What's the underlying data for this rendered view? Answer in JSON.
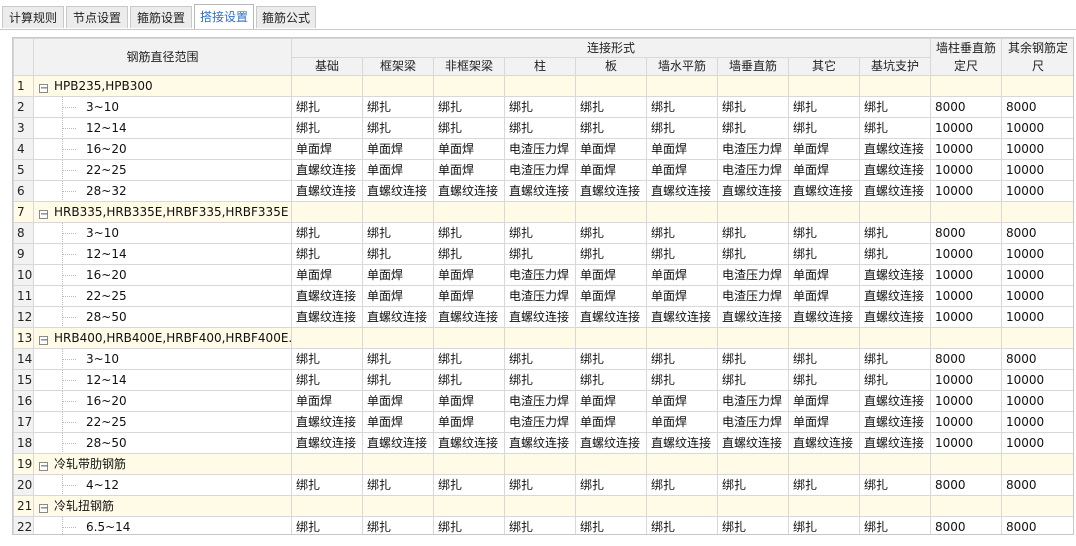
{
  "tabs": [
    {
      "label": "计算规则",
      "active": false
    },
    {
      "label": "节点设置",
      "active": false
    },
    {
      "label": "箍筋设置",
      "active": false
    },
    {
      "label": "搭接设置",
      "active": true
    },
    {
      "label": "箍筋公式",
      "active": false
    }
  ],
  "table": {
    "range_header": "钢筋直径范围",
    "group_header": "连接形式",
    "sub_headers": [
      "基础",
      "框架梁",
      "非框架梁",
      "柱",
      "板",
      "墙水平筋",
      "墙垂直筋",
      "其它",
      "基坑支护"
    ],
    "wall_col_header": "墙柱垂直筋定尺",
    "other_col_header": "其余钢筋定尺",
    "rows": [
      {
        "n": "1",
        "type": "group",
        "label": "HPB235,HPB300"
      },
      {
        "n": "2",
        "type": "data",
        "range": "3~10",
        "cells": [
          "绑扎",
          "绑扎",
          "绑扎",
          "绑扎",
          "绑扎",
          "绑扎",
          "绑扎",
          "绑扎",
          "绑扎",
          "8000",
          "8000"
        ]
      },
      {
        "n": "3",
        "type": "data",
        "range": "12~14",
        "cells": [
          "绑扎",
          "绑扎",
          "绑扎",
          "绑扎",
          "绑扎",
          "绑扎",
          "绑扎",
          "绑扎",
          "绑扎",
          "10000",
          "10000"
        ]
      },
      {
        "n": "4",
        "type": "data",
        "range": "16~20",
        "cells": [
          "单面焊",
          "单面焊",
          "单面焊",
          "电渣压力焊",
          "单面焊",
          "单面焊",
          "电渣压力焊",
          "单面焊",
          "直螺纹连接",
          "10000",
          "10000"
        ]
      },
      {
        "n": "5",
        "type": "data",
        "range": "22~25",
        "cells": [
          "直螺纹连接",
          "单面焊",
          "单面焊",
          "电渣压力焊",
          "单面焊",
          "单面焊",
          "电渣压力焊",
          "单面焊",
          "直螺纹连接",
          "10000",
          "10000"
        ]
      },
      {
        "n": "6",
        "type": "data",
        "range": "28~32",
        "cells": [
          "直螺纹连接",
          "直螺纹连接",
          "直螺纹连接",
          "直螺纹连接",
          "直螺纹连接",
          "直螺纹连接",
          "直螺纹连接",
          "直螺纹连接",
          "直螺纹连接",
          "10000",
          "10000"
        ]
      },
      {
        "n": "7",
        "type": "group",
        "label": "HRB335,HRB335E,HRBF335,HRBF335E"
      },
      {
        "n": "8",
        "type": "data",
        "range": "3~10",
        "cells": [
          "绑扎",
          "绑扎",
          "绑扎",
          "绑扎",
          "绑扎",
          "绑扎",
          "绑扎",
          "绑扎",
          "绑扎",
          "8000",
          "8000"
        ]
      },
      {
        "n": "9",
        "type": "data",
        "range": "12~14",
        "cells": [
          "绑扎",
          "绑扎",
          "绑扎",
          "绑扎",
          "绑扎",
          "绑扎",
          "绑扎",
          "绑扎",
          "绑扎",
          "10000",
          "10000"
        ]
      },
      {
        "n": "10",
        "type": "data",
        "range": "16~20",
        "cells": [
          "单面焊",
          "单面焊",
          "单面焊",
          "电渣压力焊",
          "单面焊",
          "单面焊",
          "电渣压力焊",
          "单面焊",
          "直螺纹连接",
          "10000",
          "10000"
        ]
      },
      {
        "n": "11",
        "type": "data",
        "range": "22~25",
        "cells": [
          "直螺纹连接",
          "单面焊",
          "单面焊",
          "电渣压力焊",
          "单面焊",
          "单面焊",
          "电渣压力焊",
          "单面焊",
          "直螺纹连接",
          "10000",
          "10000"
        ]
      },
      {
        "n": "12",
        "type": "data",
        "range": "28~50",
        "cells": [
          "直螺纹连接",
          "直螺纹连接",
          "直螺纹连接",
          "直螺纹连接",
          "直螺纹连接",
          "直螺纹连接",
          "直螺纹连接",
          "直螺纹连接",
          "直螺纹连接",
          "10000",
          "10000"
        ]
      },
      {
        "n": "13",
        "type": "group",
        "label": "HRB400,HRB400E,HRBF400,HRBF400E..."
      },
      {
        "n": "14",
        "type": "data",
        "range": "3~10",
        "cells": [
          "绑扎",
          "绑扎",
          "绑扎",
          "绑扎",
          "绑扎",
          "绑扎",
          "绑扎",
          "绑扎",
          "绑扎",
          "8000",
          "8000"
        ]
      },
      {
        "n": "15",
        "type": "data",
        "range": "12~14",
        "cells": [
          "绑扎",
          "绑扎",
          "绑扎",
          "绑扎",
          "绑扎",
          "绑扎",
          "绑扎",
          "绑扎",
          "绑扎",
          "10000",
          "10000"
        ]
      },
      {
        "n": "16",
        "type": "data",
        "range": "16~20",
        "cells": [
          "单面焊",
          "单面焊",
          "单面焊",
          "电渣压力焊",
          "单面焊",
          "单面焊",
          "电渣压力焊",
          "单面焊",
          "直螺纹连接",
          "10000",
          "10000"
        ]
      },
      {
        "n": "17",
        "type": "data",
        "range": "22~25",
        "cells": [
          "直螺纹连接",
          "单面焊",
          "单面焊",
          "电渣压力焊",
          "单面焊",
          "单面焊",
          "电渣压力焊",
          "单面焊",
          "直螺纹连接",
          "10000",
          "10000"
        ]
      },
      {
        "n": "18",
        "type": "data",
        "range": "28~50",
        "cells": [
          "直螺纹连接",
          "直螺纹连接",
          "直螺纹连接",
          "直螺纹连接",
          "直螺纹连接",
          "直螺纹连接",
          "直螺纹连接",
          "直螺纹连接",
          "直螺纹连接",
          "10000",
          "10000"
        ]
      },
      {
        "n": "19",
        "type": "group",
        "label": "冷轧带肋钢筋"
      },
      {
        "n": "20",
        "type": "data",
        "range": "4~12",
        "cells": [
          "绑扎",
          "绑扎",
          "绑扎",
          "绑扎",
          "绑扎",
          "绑扎",
          "绑扎",
          "绑扎",
          "绑扎",
          "8000",
          "8000"
        ]
      },
      {
        "n": "21",
        "type": "group",
        "label": "冷轧扭钢筋"
      },
      {
        "n": "22",
        "type": "data",
        "range": "6.5~14",
        "cells": [
          "绑扎",
          "绑扎",
          "绑扎",
          "绑扎",
          "绑扎",
          "绑扎",
          "绑扎",
          "绑扎",
          "绑扎",
          "8000",
          "8000"
        ]
      }
    ]
  },
  "icons": {
    "collapse": "collapse-minus-icon"
  },
  "colors": {
    "active_tab_text": "#2a6fc9",
    "group_row_bg": "#fffbe6",
    "header_bg": "#f2f2f2",
    "grid_line": "#d8d8d8"
  }
}
